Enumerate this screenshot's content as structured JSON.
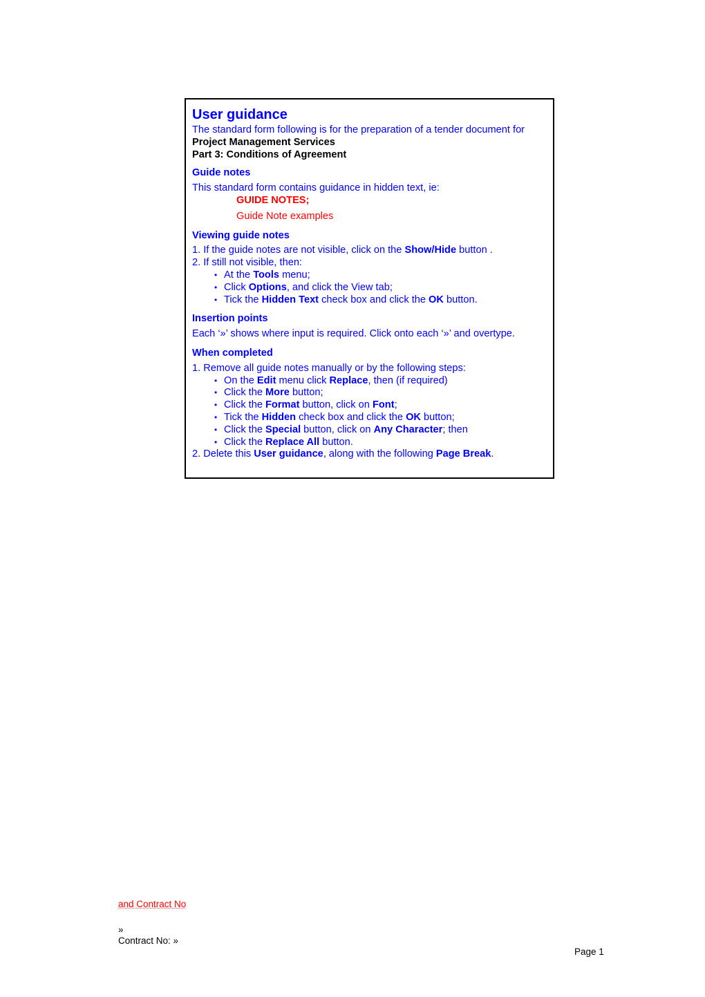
{
  "guidance": {
    "title": "User guidance",
    "intro": "The standard form following is for the preparation of a tender document for",
    "service_name": "Project Management Services",
    "part_name": "Part 3: Conditions of Agreement",
    "guide_notes": {
      "heading": "Guide notes",
      "text": "This standard form contains guidance in hidden text, ie:",
      "example_caps": "GUIDE NOTES;",
      "example_normal": "Guide Note examples"
    },
    "viewing": {
      "heading": "Viewing guide notes",
      "step1_pre": "1. If the guide notes are not visible, click on the ",
      "step1_bold": "Show/Hide",
      "step1_post": " button .",
      "step2": "2. If still not visible, then:",
      "bullets": [
        {
          "pre": "At the ",
          "bold": "Tools",
          "post": " menu;"
        },
        {
          "pre": "Click ",
          "bold": "Options",
          "post": ", and click the View tab;"
        },
        {
          "pre": "Tick the ",
          "bold": "Hidden Text",
          "mid": " check box and click the ",
          "bold2": "OK",
          "post": " button."
        }
      ]
    },
    "insertion": {
      "heading": "Insertion points",
      "text": "Each ‘»’ shows where input is required. Click onto each ‘»’ and overtype."
    },
    "completed": {
      "heading": "When completed",
      "step1": "1. Remove all guide notes manually or by the following steps:",
      "bullets": [
        {
          "pre": "On the ",
          "bold": "Edit",
          "mid": " menu click ",
          "bold2": "Replace",
          "post": ", then (if required)"
        },
        {
          "pre": "Click the ",
          "bold": "More",
          "post": " button;"
        },
        {
          "pre": "Click the ",
          "bold": "Format",
          "mid": " button, click on ",
          "bold2": "Font",
          "post": ";"
        },
        {
          "pre": "Tick the ",
          "bold": "Hidden",
          "mid": " check box and click the ",
          "bold2": "OK",
          "post": " button;"
        },
        {
          "pre": "Click the ",
          "bold": "Special",
          "mid": " button, click on ",
          "bold2": "Any Character",
          "post": "; then"
        },
        {
          "pre": "Click the ",
          "bold": "Replace All",
          "post": " button."
        }
      ],
      "step2_pre": "2. Delete this ",
      "step2_bold": "User guidance",
      "step2_mid": ", along with the following ",
      "step2_bold2": "Page Break",
      "step2_post": "."
    }
  },
  "footer": {
    "hidden_text": "and Contract No",
    "insertion_mark": "»",
    "contract_label": "Contract No: »",
    "page_label": "Page 1"
  },
  "colors": {
    "guidance_text": "#0000ff",
    "hidden_text": "#ff0000",
    "body_text": "#000000"
  }
}
